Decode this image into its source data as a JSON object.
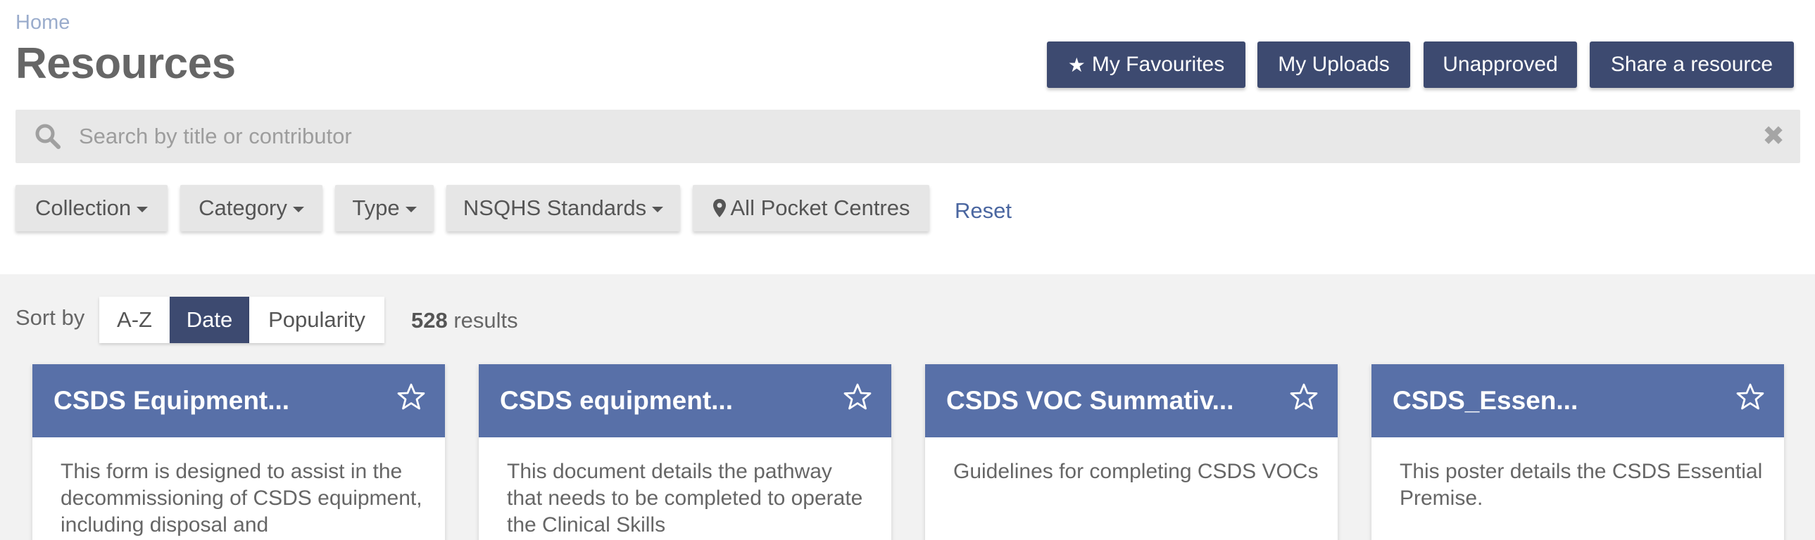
{
  "breadcrumb": {
    "home": "Home"
  },
  "page": {
    "title": "Resources"
  },
  "header_buttons": {
    "favourites": "My Favourites",
    "uploads": "My Uploads",
    "unapproved": "Unapproved",
    "share": "Share a resource"
  },
  "search": {
    "placeholder": "Search by title or contributor",
    "value": ""
  },
  "filters": {
    "collection": "Collection",
    "category": "Category",
    "type": "Type",
    "nsqhs": "NSQHS Standards",
    "centres": "All Pocket Centres",
    "reset": "Reset"
  },
  "sort": {
    "label": "Sort by",
    "options": [
      "A-Z",
      "Date",
      "Popularity"
    ],
    "selected": "Date"
  },
  "results": {
    "count": "528",
    "label": "results"
  },
  "cards": [
    {
      "title": "CSDS Equipment...",
      "description": "This form is designed to assist in the decommissioning of CSDS equipment, including disposal and"
    },
    {
      "title": "CSDS equipment...",
      "description": "This document details the pathway that needs to be completed to operate the Clinical Skills"
    },
    {
      "title": "CSDS VOC Summativ...",
      "description": "Guidelines for completing CSDS VOCs"
    },
    {
      "title": "CSDS_Essen...",
      "description": "This poster details the CSDS Essential Premise."
    }
  ],
  "colors": {
    "primary_button": "#3d4a70",
    "card_header": "#5870a8",
    "link": "#4a66a0",
    "search_bg": "#e8e8e8",
    "lower_bg": "#f2f2f2"
  },
  "icons": {
    "favourites": "star-icon",
    "search": "search-icon",
    "clear": "close-icon",
    "dropdown": "caret-down-icon",
    "location": "map-marker-icon",
    "card_favourite": "star-outline-icon"
  }
}
